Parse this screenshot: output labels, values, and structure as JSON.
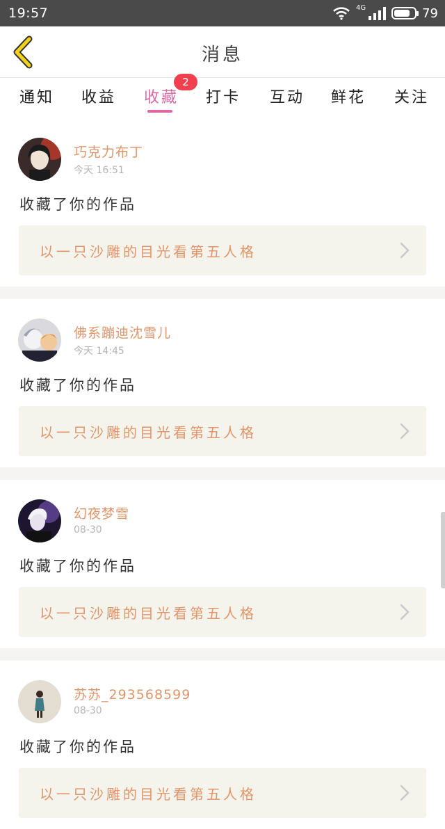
{
  "status_bar": {
    "time": "19:57",
    "network": "4G",
    "battery_level": 79,
    "battery_text": "79"
  },
  "header": {
    "title": "消息",
    "back_icon": "chevron-left-icon",
    "back_color": "#f2d21a"
  },
  "tabs": [
    {
      "label": "通知"
    },
    {
      "label": "收益"
    },
    {
      "label": "收藏",
      "active": true,
      "badge": "2"
    },
    {
      "label": "打卡"
    },
    {
      "label": "互动"
    },
    {
      "label": "鲜花"
    },
    {
      "label": "关注"
    }
  ],
  "colors": {
    "accent": "#d96aa6",
    "badge": "#f0404f",
    "username": "#e0966b",
    "link_bg": "#f4f3ec"
  },
  "notifications": [
    {
      "username": "巧克力布丁",
      "time": "今天 16:51",
      "action": "收藏了你的作品",
      "work_title": "以一只沙雕的目光看第五人格"
    },
    {
      "username": "佛系蹦迪沈雪儿",
      "time": "今天 14:45",
      "action": "收藏了你的作品",
      "work_title": "以一只沙雕的目光看第五人格"
    },
    {
      "username": "幻夜梦雪",
      "time": "08-30",
      "action": "收藏了你的作品",
      "work_title": "以一只沙雕的目光看第五人格"
    },
    {
      "username": "苏苏_293568599",
      "time": "08-30",
      "action": "收藏了你的作品",
      "work_title": "以一只沙雕的目光看第五人格"
    }
  ]
}
